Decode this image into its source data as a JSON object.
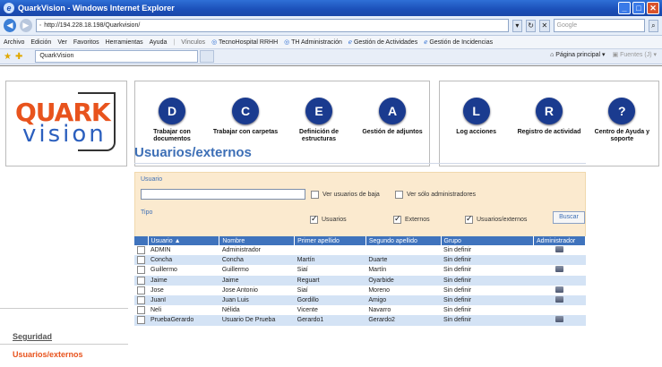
{
  "browser": {
    "title": "QuarkVision - Windows Internet Explorer",
    "url": "http://194.228.18.198/Quarkvision/",
    "search_placeholder": "Google",
    "menu": [
      "Archivo",
      "Edición",
      "Ver",
      "Favoritos",
      "Herramientas",
      "Ayuda"
    ],
    "links_label": "Vínculos",
    "links": [
      "TecnoHospital RRHH",
      "TH Administración",
      "Gestión de Actividades",
      "Gestión de Incidencias"
    ],
    "tab_title": "QuarkVision",
    "home_label": "Página principal",
    "feeds_label": "Fuentes (J)"
  },
  "logo": {
    "part1": "QUARK",
    "part2": "vision"
  },
  "toolbar_left": [
    {
      "icon": "document-icon",
      "glyph": "D",
      "label": "Trabajar con documentos"
    },
    {
      "icon": "folder-icon",
      "glyph": "C",
      "label": "Trabajar con carpetas"
    },
    {
      "icon": "structure-icon",
      "glyph": "E",
      "label": "Definición de estructuras"
    },
    {
      "icon": "attachment-icon",
      "glyph": "A",
      "label": "Gestión de adjuntos"
    }
  ],
  "toolbar_right": [
    {
      "icon": "log-icon",
      "glyph": "L",
      "label": "Log acciones"
    },
    {
      "icon": "activity-icon",
      "glyph": "R",
      "label": "Registro de actividad"
    },
    {
      "icon": "help-icon",
      "glyph": "?",
      "label": "Centro de Ayuda y soporte"
    }
  ],
  "sidebar": {
    "security_label": "Seguridad",
    "active_label": "Usuarios/externos"
  },
  "page": {
    "title": "Usuarios/externos"
  },
  "filter": {
    "usuario_legend": "Usuario",
    "usuario_value": "",
    "ver_baja_label": "Ver usuarios de baja",
    "ver_admin_label": "Ver sólo administradores",
    "tipo_legend": "Tipo",
    "tipo_usuarios": "Usuarios",
    "tipo_externos": "Externos",
    "tipo_usuarios_externos": "Usuarios/externos",
    "buscar_label": "Buscar"
  },
  "table": {
    "columns": [
      "Usuario ▲",
      "Nombre",
      "Primer apellido",
      "Segundo apellido",
      "Grupo",
      "Administrador"
    ],
    "rows": [
      {
        "usuario": "ADMIN",
        "nombre": "Administrador",
        "apellido1": "",
        "apellido2": "",
        "grupo": "Sin definir",
        "admin": true
      },
      {
        "usuario": "Concha",
        "nombre": "Concha",
        "apellido1": "Martín",
        "apellido2": "Duarte",
        "grupo": "Sin definir",
        "admin": false
      },
      {
        "usuario": "Guillermo",
        "nombre": "Guillermo",
        "apellido1": "Siaí",
        "apellido2": "Martín",
        "grupo": "Sin definir",
        "admin": true
      },
      {
        "usuario": "Jaime",
        "nombre": "Jaime",
        "apellido1": "Reguart",
        "apellido2": "Oyarbide",
        "grupo": "Sin definir",
        "admin": false
      },
      {
        "usuario": "Jose",
        "nombre": "Jose Antonio",
        "apellido1": "Siaí",
        "apellido2": "Moreno",
        "grupo": "Sin definir",
        "admin": true
      },
      {
        "usuario": "JuanI",
        "nombre": "Juan Luis",
        "apellido1": "Gordillo",
        "apellido2": "Amigo",
        "grupo": "Sin definir",
        "admin": true
      },
      {
        "usuario": "Neli",
        "nombre": "Nélida",
        "apellido1": "Vicente",
        "apellido2": "Navarro",
        "grupo": "Sin definir",
        "admin": false
      },
      {
        "usuario": "PruebaGerardo",
        "nombre": "Usuario De Prueba",
        "apellido1": "Gerardo1",
        "apellido2": "Gerardo2",
        "grupo": "Sin definir",
        "admin": true
      }
    ]
  }
}
